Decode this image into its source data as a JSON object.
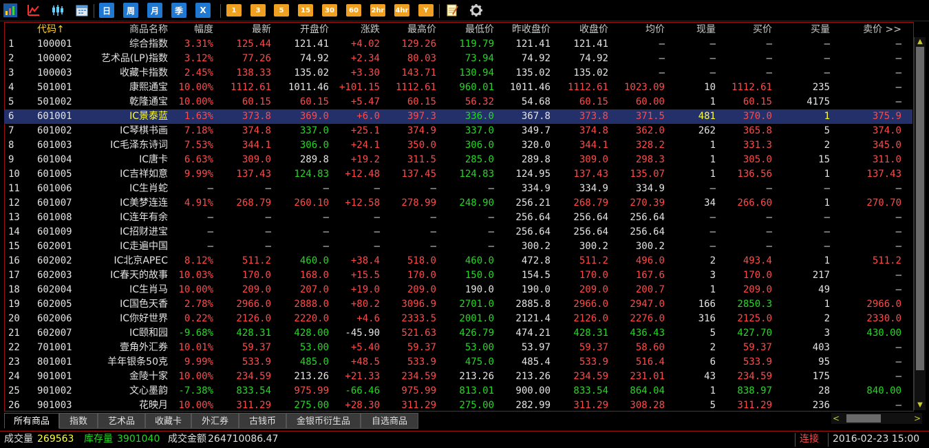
{
  "toolbar": {
    "buttons": [
      {
        "name": "quote-list-icon",
        "kind": "icon"
      },
      {
        "name": "line-chart-icon",
        "kind": "icon"
      },
      {
        "name": "candlestick-icon",
        "kind": "icon"
      },
      {
        "name": "calendar-icon",
        "kind": "icon"
      },
      {
        "name": "period-day-button",
        "kind": "blue",
        "label": "日"
      },
      {
        "name": "period-week-button",
        "kind": "blue",
        "label": "周"
      },
      {
        "name": "period-month-button",
        "kind": "blue",
        "label": "月"
      },
      {
        "name": "period-season-button",
        "kind": "blue",
        "label": "季"
      },
      {
        "name": "period-x-button",
        "kind": "blue",
        "label": "X"
      },
      {
        "name": "period-1min-button",
        "kind": "orange",
        "label": "1"
      },
      {
        "name": "period-3min-button",
        "kind": "orange",
        "label": "3"
      },
      {
        "name": "period-5min-button",
        "kind": "orange",
        "label": "5"
      },
      {
        "name": "period-15min-button",
        "kind": "orange",
        "label": "15"
      },
      {
        "name": "period-30min-button",
        "kind": "orange",
        "label": "30"
      },
      {
        "name": "period-60min-button",
        "kind": "orange",
        "label": "60"
      },
      {
        "name": "period-2hr-button",
        "kind": "orange",
        "label": "2hr"
      },
      {
        "name": "period-4hr-button",
        "kind": "orange",
        "label": "4hr"
      },
      {
        "name": "period-year-button",
        "kind": "orange",
        "label": "Y"
      },
      {
        "name": "notepad-icon",
        "kind": "icon"
      },
      {
        "name": "gear-icon",
        "kind": "icon"
      }
    ]
  },
  "table": {
    "headers": [
      "",
      "代码↑",
      "商品名称",
      "幅度",
      "最新",
      "开盘价",
      "涨跌",
      "最高价",
      "最低价",
      "昨收盘价",
      "收盘价",
      "均价",
      "现量",
      "买价",
      "买量",
      "卖价 >>"
    ],
    "selected_row": 6,
    "rows": [
      {
        "cells": [
          "1",
          "100001",
          "综合指数",
          "3.31%",
          "125.44",
          "121.41",
          "+4.02",
          "129.26",
          "119.79",
          "121.41",
          "121.41",
          "—",
          "—",
          "—",
          "—",
          "—"
        ],
        "colors": [
          "w",
          "w",
          "w",
          "u",
          "u",
          "w",
          "u",
          "u",
          "d",
          "w",
          "w",
          "w",
          "w",
          "w",
          "w",
          "w"
        ]
      },
      {
        "cells": [
          "2",
          "100002",
          "艺术品(LP)指数",
          "3.12%",
          "77.26",
          "74.92",
          "+2.34",
          "80.03",
          "73.94",
          "74.92",
          "74.92",
          "—",
          "—",
          "—",
          "—",
          "—"
        ],
        "colors": [
          "w",
          "w",
          "w",
          "u",
          "u",
          "w",
          "u",
          "u",
          "d",
          "w",
          "w",
          "w",
          "w",
          "w",
          "w",
          "w"
        ]
      },
      {
        "cells": [
          "3",
          "100003",
          "收藏卡指数",
          "2.45%",
          "138.33",
          "135.02",
          "+3.30",
          "143.71",
          "130.94",
          "135.02",
          "135.02",
          "—",
          "—",
          "—",
          "—",
          "—"
        ],
        "colors": [
          "w",
          "w",
          "w",
          "u",
          "u",
          "w",
          "u",
          "u",
          "d",
          "w",
          "w",
          "w",
          "w",
          "w",
          "w",
          "w"
        ]
      },
      {
        "cells": [
          "4",
          "501001",
          "康熙通宝",
          "10.00%",
          "1112.61",
          "1011.46",
          "+101.15",
          "1112.61",
          "960.01",
          "1011.46",
          "1112.61",
          "1023.09",
          "10",
          "1112.61",
          "235",
          "—"
        ],
        "colors": [
          "w",
          "w",
          "w",
          "u",
          "u",
          "w",
          "u",
          "u",
          "d",
          "w",
          "u",
          "u",
          "w",
          "u",
          "w",
          "w"
        ]
      },
      {
        "cells": [
          "5",
          "501002",
          "乾隆通宝",
          "10.00%",
          "60.15",
          "60.15",
          "+5.47",
          "60.15",
          "56.32",
          "54.68",
          "60.15",
          "60.00",
          "1",
          "60.15",
          "4175",
          "—"
        ],
        "colors": [
          "w",
          "w",
          "w",
          "u",
          "u",
          "u",
          "u",
          "u",
          "u",
          "w",
          "u",
          "u",
          "w",
          "u",
          "w",
          "w"
        ]
      },
      {
        "cells": [
          "6",
          "601001",
          "IC景泰蓝",
          "1.63%",
          "373.8",
          "369.0",
          "+6.0",
          "397.3",
          "336.0",
          "367.8",
          "373.8",
          "371.5",
          "481",
          "370.0",
          "1",
          "375.9"
        ],
        "colors": [
          "w",
          "w",
          "y",
          "u",
          "u",
          "u",
          "u",
          "u",
          "d",
          "w",
          "u",
          "u",
          "y",
          "u",
          "y",
          "u"
        ]
      },
      {
        "cells": [
          "7",
          "601002",
          "IC琴棋书画",
          "7.18%",
          "374.8",
          "337.0",
          "+25.1",
          "374.9",
          "337.0",
          "349.7",
          "374.8",
          "362.0",
          "262",
          "365.8",
          "5",
          "374.0"
        ],
        "colors": [
          "w",
          "w",
          "w",
          "u",
          "u",
          "d",
          "u",
          "u",
          "d",
          "w",
          "u",
          "u",
          "w",
          "u",
          "w",
          "u"
        ]
      },
      {
        "cells": [
          "8",
          "601003",
          "IC毛泽东诗词",
          "7.53%",
          "344.1",
          "306.0",
          "+24.1",
          "350.0",
          "306.0",
          "320.0",
          "344.1",
          "328.2",
          "1",
          "331.3",
          "2",
          "345.0"
        ],
        "colors": [
          "w",
          "w",
          "w",
          "u",
          "u",
          "d",
          "u",
          "u",
          "d",
          "w",
          "u",
          "u",
          "w",
          "u",
          "w",
          "u"
        ]
      },
      {
        "cells": [
          "9",
          "601004",
          "IC唐卡",
          "6.63%",
          "309.0",
          "289.8",
          "+19.2",
          "311.5",
          "285.0",
          "289.8",
          "309.0",
          "298.3",
          "1",
          "305.0",
          "15",
          "311.0"
        ],
        "colors": [
          "w",
          "w",
          "w",
          "u",
          "u",
          "w",
          "u",
          "u",
          "d",
          "w",
          "u",
          "u",
          "w",
          "u",
          "w",
          "u"
        ]
      },
      {
        "cells": [
          "10",
          "601005",
          "IC吉祥如意",
          "9.99%",
          "137.43",
          "124.83",
          "+12.48",
          "137.45",
          "124.83",
          "124.95",
          "137.43",
          "135.07",
          "1",
          "136.56",
          "1",
          "137.43"
        ],
        "colors": [
          "w",
          "w",
          "w",
          "u",
          "u",
          "d",
          "u",
          "u",
          "d",
          "w",
          "u",
          "u",
          "w",
          "u",
          "w",
          "u"
        ]
      },
      {
        "cells": [
          "11",
          "601006",
          "IC生肖蛇",
          "—",
          "—",
          "—",
          "—",
          "—",
          "—",
          "334.9",
          "334.9",
          "334.9",
          "—",
          "—",
          "—",
          "—"
        ],
        "colors": [
          "w",
          "w",
          "w",
          "w",
          "w",
          "w",
          "w",
          "w",
          "w",
          "w",
          "w",
          "w",
          "w",
          "w",
          "w",
          "w"
        ]
      },
      {
        "cells": [
          "12",
          "601007",
          "IC美梦连连",
          "4.91%",
          "268.79",
          "260.10",
          "+12.58",
          "278.99",
          "248.90",
          "256.21",
          "268.79",
          "270.39",
          "34",
          "266.60",
          "1",
          "270.70"
        ],
        "colors": [
          "w",
          "w",
          "w",
          "u",
          "u",
          "u",
          "u",
          "u",
          "d",
          "w",
          "u",
          "u",
          "w",
          "u",
          "w",
          "u"
        ]
      },
      {
        "cells": [
          "13",
          "601008",
          "IC连年有余",
          "—",
          "—",
          "—",
          "—",
          "—",
          "—",
          "256.64",
          "256.64",
          "256.64",
          "—",
          "—",
          "—",
          "—"
        ],
        "colors": [
          "w",
          "w",
          "w",
          "w",
          "w",
          "w",
          "w",
          "w",
          "w",
          "w",
          "w",
          "w",
          "w",
          "w",
          "w",
          "w"
        ]
      },
      {
        "cells": [
          "14",
          "601009",
          "IC招财进宝",
          "—",
          "—",
          "—",
          "—",
          "—",
          "—",
          "256.64",
          "256.64",
          "256.64",
          "—",
          "—",
          "—",
          "—"
        ],
        "colors": [
          "w",
          "w",
          "w",
          "w",
          "w",
          "w",
          "w",
          "w",
          "w",
          "w",
          "w",
          "w",
          "w",
          "w",
          "w",
          "w"
        ]
      },
      {
        "cells": [
          "15",
          "602001",
          "IC走遍中国",
          "—",
          "—",
          "—",
          "—",
          "—",
          "—",
          "300.2",
          "300.2",
          "300.2",
          "—",
          "—",
          "—",
          "—"
        ],
        "colors": [
          "w",
          "w",
          "w",
          "w",
          "w",
          "w",
          "w",
          "w",
          "w",
          "w",
          "w",
          "w",
          "w",
          "w",
          "w",
          "w"
        ]
      },
      {
        "cells": [
          "16",
          "602002",
          "IC北京APEC",
          "8.12%",
          "511.2",
          "460.0",
          "+38.4",
          "518.0",
          "460.0",
          "472.8",
          "511.2",
          "496.0",
          "2",
          "493.4",
          "1",
          "511.2"
        ],
        "colors": [
          "w",
          "w",
          "w",
          "u",
          "u",
          "d",
          "u",
          "u",
          "d",
          "w",
          "u",
          "u",
          "w",
          "u",
          "w",
          "u"
        ]
      },
      {
        "cells": [
          "17",
          "602003",
          "IC春天的故事",
          "10.03%",
          "170.0",
          "168.0",
          "+15.5",
          "170.0",
          "150.0",
          "154.5",
          "170.0",
          "167.6",
          "3",
          "170.0",
          "217",
          "—"
        ],
        "colors": [
          "w",
          "w",
          "w",
          "u",
          "u",
          "u",
          "u",
          "u",
          "d",
          "w",
          "u",
          "u",
          "w",
          "u",
          "w",
          "w"
        ]
      },
      {
        "cells": [
          "18",
          "602004",
          "IC生肖马",
          "10.00%",
          "209.0",
          "207.0",
          "+19.0",
          "209.0",
          "190.0",
          "190.0",
          "209.0",
          "200.7",
          "1",
          "209.0",
          "49",
          "—"
        ],
        "colors": [
          "w",
          "w",
          "w",
          "u",
          "u",
          "u",
          "u",
          "u",
          "w",
          "w",
          "u",
          "u",
          "w",
          "u",
          "w",
          "w"
        ]
      },
      {
        "cells": [
          "19",
          "602005",
          "IC国色天香",
          "2.78%",
          "2966.0",
          "2888.0",
          "+80.2",
          "3096.9",
          "2701.0",
          "2885.8",
          "2966.0",
          "2947.0",
          "166",
          "2850.3",
          "1",
          "2966.0"
        ],
        "colors": [
          "w",
          "w",
          "w",
          "u",
          "u",
          "u",
          "u",
          "u",
          "d",
          "w",
          "u",
          "u",
          "w",
          "d",
          "w",
          "u"
        ]
      },
      {
        "cells": [
          "20",
          "602006",
          "IC你好世界",
          "0.22%",
          "2126.0",
          "2220.0",
          "+4.6",
          "2333.5",
          "2001.0",
          "2121.4",
          "2126.0",
          "2276.0",
          "316",
          "2125.0",
          "2",
          "2330.0"
        ],
        "colors": [
          "w",
          "w",
          "w",
          "u",
          "u",
          "u",
          "u",
          "u",
          "d",
          "w",
          "u",
          "u",
          "w",
          "u",
          "w",
          "u"
        ]
      },
      {
        "cells": [
          "21",
          "602007",
          "IC颐和园",
          "-9.68%",
          "428.31",
          "428.00",
          "-45.90",
          "521.63",
          "426.79",
          "474.21",
          "428.31",
          "436.43",
          "5",
          "427.70",
          "3",
          "430.00"
        ],
        "colors": [
          "w",
          "w",
          "w",
          "d",
          "d",
          "d",
          "w",
          "u",
          "d",
          "w",
          "d",
          "d",
          "w",
          "d",
          "w",
          "d"
        ]
      },
      {
        "cells": [
          "22",
          "701001",
          "壹角外汇券",
          "10.01%",
          "59.37",
          "53.00",
          "+5.40",
          "59.37",
          "53.00",
          "53.97",
          "59.37",
          "58.60",
          "2",
          "59.37",
          "403",
          "—"
        ],
        "colors": [
          "w",
          "w",
          "w",
          "u",
          "u",
          "d",
          "u",
          "u",
          "d",
          "w",
          "u",
          "u",
          "w",
          "u",
          "w",
          "w"
        ]
      },
      {
        "cells": [
          "23",
          "801001",
          "羊年银条50克",
          "9.99%",
          "533.9",
          "485.0",
          "+48.5",
          "533.9",
          "475.0",
          "485.4",
          "533.9",
          "516.4",
          "6",
          "533.9",
          "95",
          "—"
        ],
        "colors": [
          "w",
          "w",
          "w",
          "u",
          "u",
          "d",
          "u",
          "u",
          "d",
          "w",
          "u",
          "u",
          "w",
          "u",
          "w",
          "w"
        ]
      },
      {
        "cells": [
          "24",
          "901001",
          "金陵十家",
          "10.00%",
          "234.59",
          "213.26",
          "+21.33",
          "234.59",
          "213.26",
          "213.26",
          "234.59",
          "231.01",
          "43",
          "234.59",
          "175",
          "—"
        ],
        "colors": [
          "w",
          "w",
          "w",
          "u",
          "u",
          "w",
          "u",
          "u",
          "w",
          "w",
          "u",
          "u",
          "w",
          "u",
          "w",
          "w"
        ]
      },
      {
        "cells": [
          "25",
          "901002",
          "文心墨韵",
          "-7.38%",
          "833.54",
          "975.99",
          "-66.46",
          "975.99",
          "813.01",
          "900.00",
          "833.54",
          "864.04",
          "1",
          "838.97",
          "28",
          "840.00"
        ],
        "colors": [
          "w",
          "w",
          "w",
          "d",
          "d",
          "u",
          "d",
          "u",
          "d",
          "w",
          "d",
          "d",
          "w",
          "d",
          "w",
          "d"
        ]
      },
      {
        "cells": [
          "26",
          "901003",
          "花映月",
          "10.00%",
          "311.29",
          "275.00",
          "+28.30",
          "311.29",
          "275.00",
          "282.99",
          "311.29",
          "308.28",
          "5",
          "311.29",
          "236",
          "—"
        ],
        "colors": [
          "w",
          "w",
          "w",
          "u",
          "u",
          "d",
          "u",
          "u",
          "d",
          "w",
          "u",
          "u",
          "w",
          "u",
          "w",
          "w"
        ]
      }
    ]
  },
  "tabs": [
    {
      "label": "所有商品",
      "active": true
    },
    {
      "label": "指数",
      "active": false
    },
    {
      "label": "艺术品",
      "active": false
    },
    {
      "label": "收藏卡",
      "active": false
    },
    {
      "label": "外汇券",
      "active": false
    },
    {
      "label": "古钱币",
      "active": false
    },
    {
      "label": "金银币衍生品",
      "active": false
    },
    {
      "label": "自选商品",
      "active": false
    }
  ],
  "status": {
    "volume_label": "成交量",
    "volume_value": "269563",
    "stock_label": "库存量",
    "stock_value": "3901040",
    "amount_label": "成交金额",
    "amount_value": "264710086.47",
    "connection": "连接",
    "datetime": "2016-02-23 15:00"
  },
  "colors": {
    "up": "#ff4a4a",
    "down": "#24d824",
    "neutral": "#e4e4e4",
    "highlight": "#ffff30",
    "selected_row_bg": "#23306a",
    "border": "#a01010"
  }
}
